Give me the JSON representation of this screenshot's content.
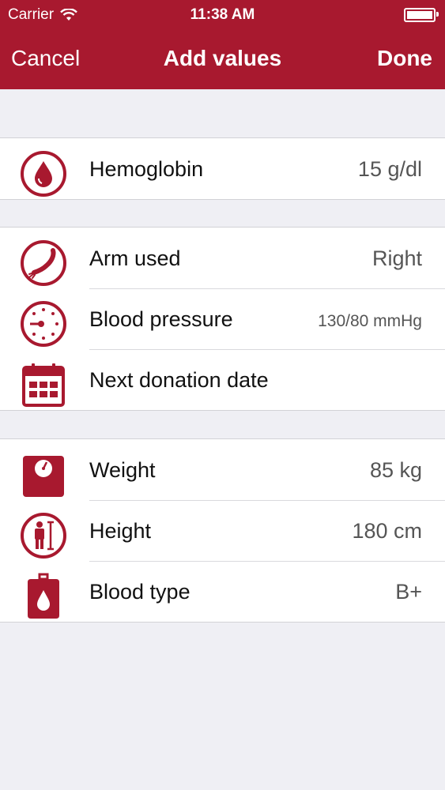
{
  "status_bar": {
    "carrier": "Carrier",
    "time": "11:38 AM"
  },
  "nav": {
    "cancel_label": "Cancel",
    "title": "Add values",
    "done_label": "Done"
  },
  "theme": {
    "accent": "#a8192f",
    "background": "#efeff4"
  },
  "groups": [
    {
      "rows": [
        {
          "label": "Hemoglobin",
          "value": "15 g/dl",
          "icon": "blood-drop-icon"
        }
      ]
    },
    {
      "rows": [
        {
          "label": "Arm used",
          "value": "Right",
          "icon": "arm-icon"
        },
        {
          "label": "Blood pressure",
          "value": "130/80 mmHg",
          "icon": "pressure-gauge-icon"
        },
        {
          "label": "Next donation date",
          "value": "",
          "icon": "calendar-icon"
        }
      ]
    },
    {
      "rows": [
        {
          "label": "Weight",
          "value": "85 kg",
          "icon": "scale-icon"
        },
        {
          "label": "Height",
          "value": "180 cm",
          "icon": "height-icon"
        },
        {
          "label": "Blood type",
          "value": "B+",
          "icon": "blood-bag-icon"
        }
      ]
    }
  ]
}
